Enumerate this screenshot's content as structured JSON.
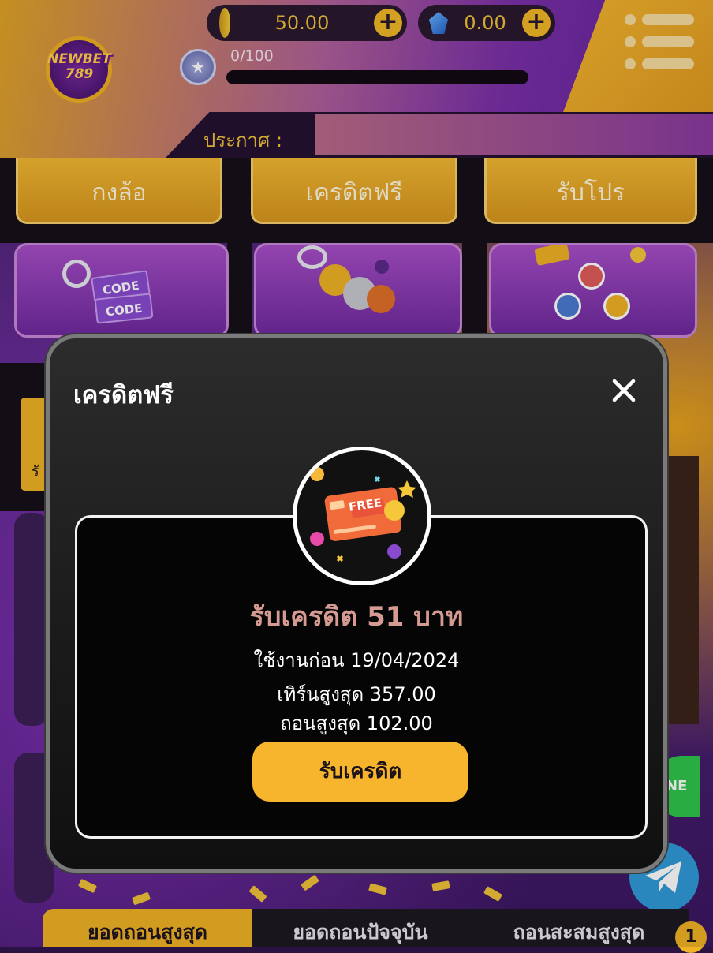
{
  "header": {
    "logo_text": "NEWBET 789",
    "coin_balance": "50.00",
    "gem_balance": "0.00",
    "xp_progress": "0/100",
    "xp_fraction": 0.0,
    "announcement_label": "ประกาศ :"
  },
  "categories": [
    {
      "label": "กงล้อ"
    },
    {
      "label": "เครดิตฟรี"
    },
    {
      "label": "รับโปร"
    }
  ],
  "modal": {
    "title": "เครดิตฟรี",
    "emblem_card_text": "FREE",
    "credit_title": "รับเครดิต 51 บาท",
    "use_before": "ใช้งานก่อน 19/04/2024",
    "max_turnover": "เทิร์นสูงสุด 357.00",
    "max_withdraw": "ถอนสูงสุด 102.00",
    "claim_button": "รับเครดิต"
  },
  "promo_card_text": [
    "CODE",
    "CODE"
  ],
  "left_panel_text": "รั",
  "social": {
    "line_label": "NE"
  },
  "tabs": [
    {
      "label": "ยอดถอนสูงสุด",
      "active": true
    },
    {
      "label": "ยอดถอนปัจจุบัน",
      "active": false
    },
    {
      "label": "ถอนสะสมสูงสุด",
      "active": false
    }
  ],
  "tab_badge": "1",
  "colors": {
    "accent": "#f7b52e",
    "modal_bg": "#1b1b1b",
    "credit_title": "#d59a92"
  }
}
